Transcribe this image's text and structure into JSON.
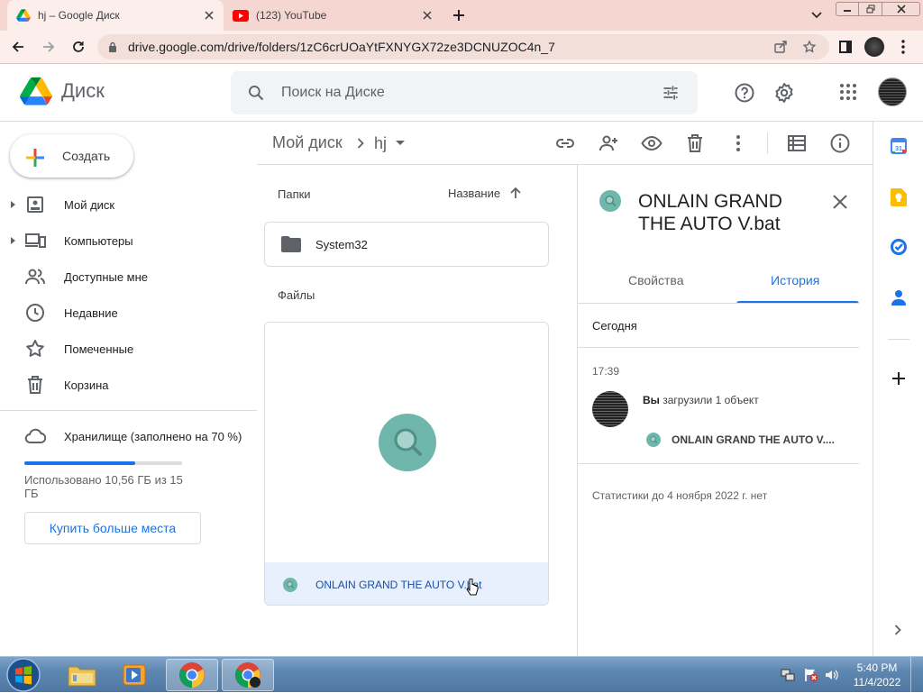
{
  "browser": {
    "tabs": [
      {
        "title": "hj – Google Диск",
        "active": true
      },
      {
        "title": "(123) YouTube",
        "active": false
      }
    ],
    "url": "drive.google.com/drive/folders/1zC6crUOaYtFXNYGX72ze3DCNUZOC4n_7"
  },
  "header": {
    "app_name": "Диск",
    "search_placeholder": "Поиск на Диске"
  },
  "sidebar": {
    "create_label": "Создать",
    "items": [
      {
        "label": "Мой диск",
        "icon": "my-drive-icon"
      },
      {
        "label": "Компьютеры",
        "icon": "computers-icon"
      },
      {
        "label": "Доступные мне",
        "icon": "shared-icon"
      },
      {
        "label": "Недавние",
        "icon": "clock-icon"
      },
      {
        "label": "Помеченные",
        "icon": "star-icon"
      },
      {
        "label": "Корзина",
        "icon": "trash-icon"
      }
    ],
    "storage": {
      "label": "Хранилище (заполнено на 70 %)",
      "percent": 70,
      "used_text": "Использовано 10,56 ГБ из 15 ГБ",
      "buy_label": "Купить больше места"
    }
  },
  "breadcrumb": {
    "root": "Мой диск",
    "current": "hj"
  },
  "content": {
    "folders_heading": "Папки",
    "sort_label": "Название",
    "folders": [
      {
        "name": "System32"
      }
    ],
    "files_heading": "Файлы",
    "files": [
      {
        "name": "ONLAIN GRAND THE AUTO V.bat"
      }
    ]
  },
  "details": {
    "title": "ONLAIN GRAND THE AUTO V.bat",
    "tabs": [
      "Свойства",
      "История"
    ],
    "active_tab": "История",
    "group": "Сегодня",
    "time": "17:39",
    "actor": "Вы",
    "action": " загрузили 1 объект",
    "item_name": "ONLAIN GRAND THE AUTO V....",
    "stats_note": "Статистики до 4 ноября 2022 г. нет"
  },
  "taskbar": {
    "time": "5:40 PM",
    "date": "11/4/2022"
  },
  "colors": {
    "accent": "#1a73e8",
    "tabstrip": "#f6d6d0",
    "file_teal": "#6fb6ab"
  }
}
